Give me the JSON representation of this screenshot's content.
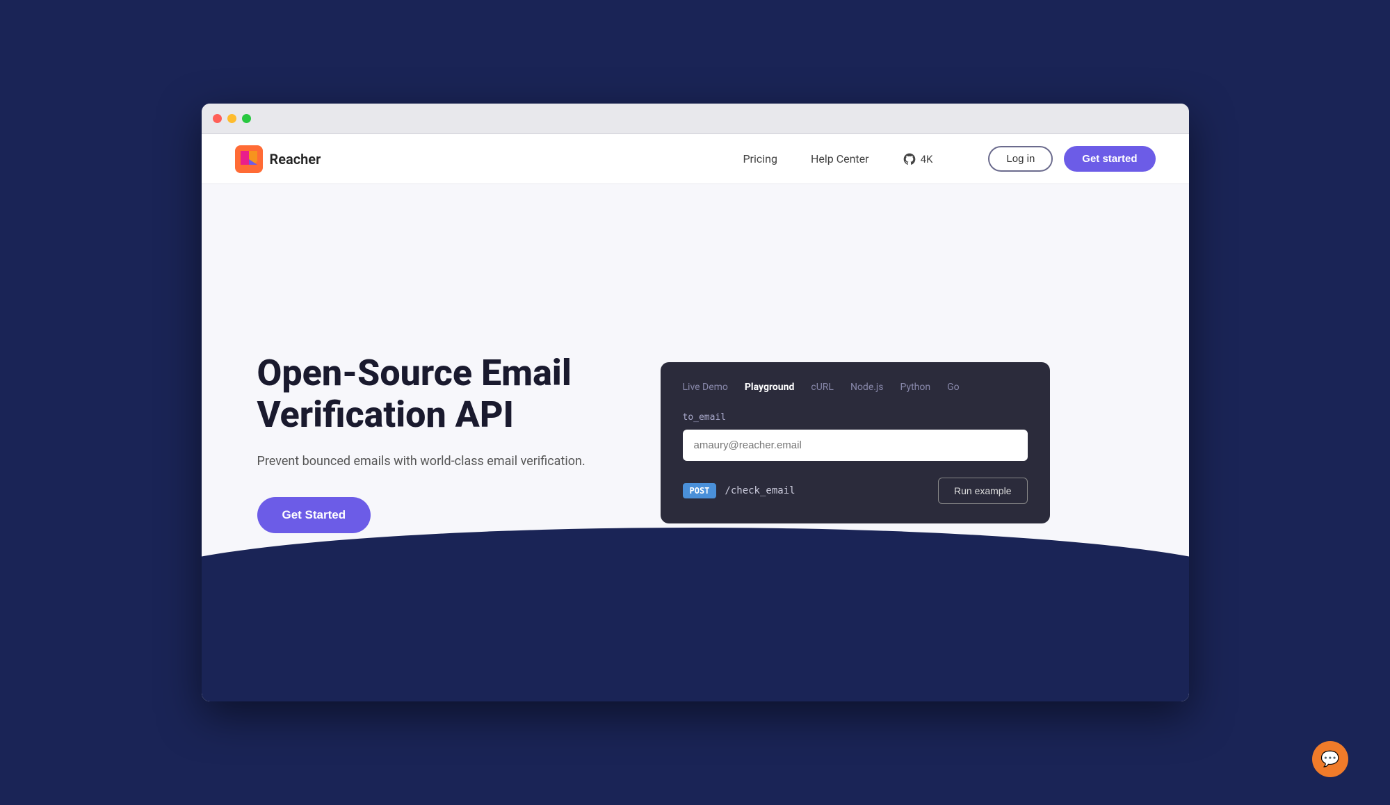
{
  "browser": {
    "traffic_lights": [
      "red",
      "yellow",
      "green"
    ]
  },
  "navbar": {
    "logo_name": "Reacher",
    "nav_links": [
      {
        "id": "pricing",
        "label": "Pricing"
      },
      {
        "id": "help-center",
        "label": "Help Center"
      }
    ],
    "github": {
      "label": "4K",
      "icon": "github-icon"
    },
    "login_label": "Log in",
    "get_started_label": "Get started"
  },
  "hero": {
    "title": "Open-Source Email Verification API",
    "subtitle": "Prevent bounced emails with world-class email verification.",
    "cta_label": "Get Started"
  },
  "demo_card": {
    "tabs": [
      {
        "id": "live-demo",
        "label": "Live Demo",
        "active": false
      },
      {
        "id": "playground",
        "label": "Playground",
        "active": true
      },
      {
        "id": "curl",
        "label": "cURL",
        "active": false
      },
      {
        "id": "nodejs",
        "label": "Node.js",
        "active": false
      },
      {
        "id": "python",
        "label": "Python",
        "active": false
      },
      {
        "id": "go",
        "label": "Go",
        "active": false
      }
    ],
    "form": {
      "label": "to_email",
      "placeholder": "amaury@reacher.email",
      "value": "amaury@reacher.email"
    },
    "method": "POST",
    "endpoint": "/check_email",
    "run_button_label": "Run example"
  },
  "chat_button": {
    "icon": "chat-icon"
  }
}
